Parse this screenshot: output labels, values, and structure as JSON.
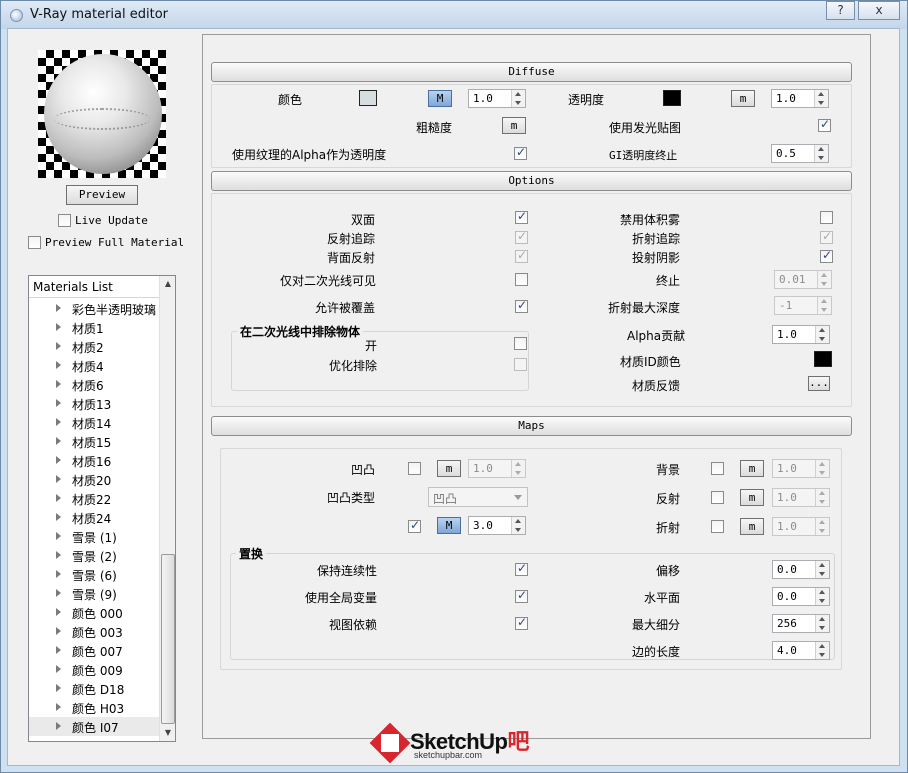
{
  "window": {
    "title": "V-Ray material editor",
    "help_label": "?",
    "close_label": "x"
  },
  "left": {
    "preview_button": "Preview",
    "live_update": "Live Update",
    "preview_full": "Preview Full Material",
    "list_title": "Materials List",
    "items": [
      "彩色半透明玻璃",
      "材质1",
      "材质2",
      "材质4",
      "材质6",
      "材质13",
      "材质14",
      "材质15",
      "材质16",
      "材质20",
      "材质22",
      "材质24",
      "雪景 (1)",
      "雪景 (2)",
      "雪景 (6)",
      "雪景 (9)",
      "颜色 000",
      "颜色 003",
      "颜色 007",
      "颜色 009",
      "颜色 D18",
      "颜色 H03",
      "颜色 I07"
    ],
    "selected_item": "颜色 I07"
  },
  "diffuse": {
    "header": "Diffuse",
    "color_label": "颜色",
    "color_value": "#d7dee0",
    "color_map_btn": "M",
    "color_mult": "1.0",
    "transparency_label": "透明度",
    "transparency_color": "#000000",
    "transparency_map_btn": "m",
    "transparency_mult": "1.0",
    "roughness_label": "粗糙度",
    "roughness_map_btn": "m",
    "use_illum_map": "使用发光贴图",
    "use_tex_alpha": "使用纹理的Alpha作为透明度",
    "gi_cutoff_label": "GI透明度终止",
    "gi_cutoff_value": "0.5"
  },
  "options": {
    "header": "Options",
    "double_sided": "双面",
    "trace_reflections": "反射追踪",
    "reflect_backside": "背面反射",
    "secondary_only": "仅对二次光线可见",
    "allow_overrides": "允许被覆盖",
    "exclude_group": "在二次光线中排除物体",
    "exclude_on": "开",
    "optimize_exclusion": "优化排除",
    "disable_volume_fog": "禁用体积雾",
    "trace_refractions": "折射追踪",
    "cast_shadows": "投射阴影",
    "cutoff_label": "终止",
    "cutoff_value": "0.01",
    "max_refr_depth_label": "折射最大深度",
    "max_refr_depth_value": "-1",
    "alpha_contrib_label": "Alpha贡献",
    "alpha_contrib_value": "1.0",
    "material_id_label": "材质ID颜色",
    "material_id_color": "#000000",
    "feedback_label": "材质反馈",
    "feedback_btn": "..."
  },
  "maps": {
    "header": "Maps",
    "bump_label": "凹凸",
    "bump_map_btn": "m",
    "bump_mult": "1.0",
    "bump_type_label": "凹凸类型",
    "bump_type_value": "凹凸",
    "disp_map_btn": "M",
    "disp_mult": "3.0",
    "background_label": "背景",
    "background_map_btn": "m",
    "background_mult": "1.0",
    "reflection_label": "反射",
    "reflection_map_btn": "m",
    "reflection_mult": "1.0",
    "refraction_label": "折射",
    "refraction_map_btn": "m",
    "refraction_mult": "1.0",
    "displacement_group": "置换",
    "keep_continuity": "保持连续性",
    "use_global": "使用全局变量",
    "view_dependent": "视图依赖",
    "shift_label": "偏移",
    "shift_value": "0.0",
    "water_level_label": "水平面",
    "water_level_value": "0.0",
    "max_subdivs_label": "最大细分",
    "max_subdivs_value": "256",
    "edge_length_label": "边的长度",
    "edge_length_value": "4.0"
  },
  "watermark": {
    "brand": "SketchUp",
    "brand_suffix": "吧",
    "url": "sketchupbar.com"
  }
}
